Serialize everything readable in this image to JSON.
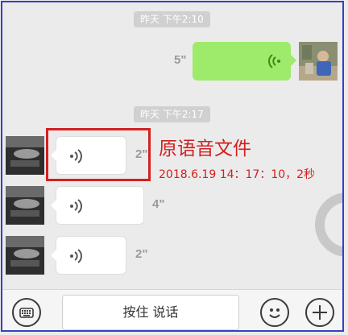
{
  "chat": {
    "messages": [
      {
        "timestamp": "昨天 下午2:10"
      },
      {
        "duration": "5\""
      },
      {
        "timestamp": "昨天 下午2:17"
      },
      {
        "duration": "2\""
      },
      {
        "duration": "4\""
      },
      {
        "duration": "2\""
      }
    ]
  },
  "annotation": {
    "title": "原语音文件",
    "subtitle": "2018.6.19 14：17：10，2秒",
    "color": "#d42020"
  },
  "toolbar": {
    "keyboard_icon": "keyboard-icon",
    "hold_to_talk_label": "按住 说话",
    "emoji_icon": "emoji-icon",
    "plus_icon": "plus-icon"
  },
  "colors": {
    "sent_bubble": "#9eea6a",
    "received_bubble": "#ffffff",
    "background": "#ebebeb",
    "frame_border": "#3a3fc4"
  }
}
